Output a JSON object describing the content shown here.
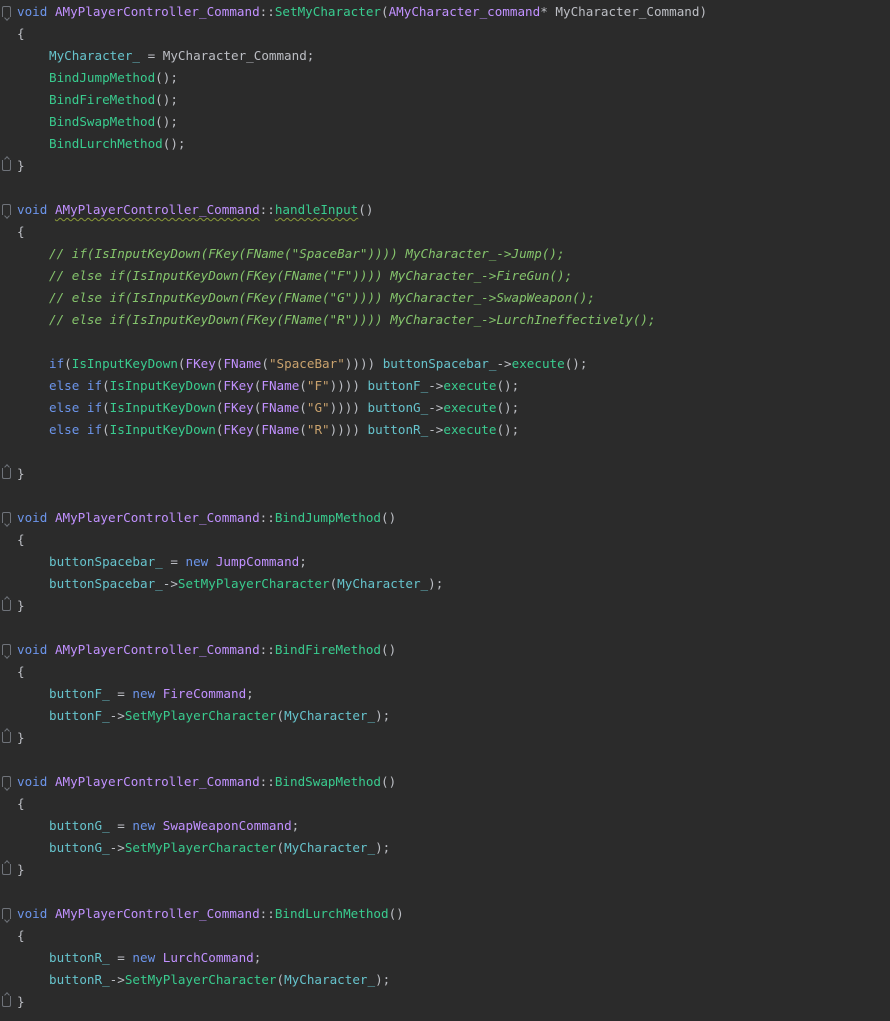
{
  "editor": {
    "theme": {
      "background": "#2b2b2b",
      "keyword": "#6c95eb",
      "type": "#c191ff",
      "function": "#39cc8f",
      "variable": "#66c3cc",
      "string": "#c9a26d",
      "comment": "#85c46c",
      "plain": "#bcbec4"
    },
    "lines": [
      {
        "fold": "open",
        "indent": 0,
        "tokens": [
          {
            "t": "void",
            "c": "kw"
          },
          {
            "t": " ",
            "c": "p"
          },
          {
            "t": "AMyPlayerController_Command",
            "c": "type"
          },
          {
            "t": "::",
            "c": "p"
          },
          {
            "t": "SetMyCharacter",
            "c": "fn"
          },
          {
            "t": "(",
            "c": "p"
          },
          {
            "t": "AMyCharacter_command",
            "c": "type"
          },
          {
            "t": "* MyCharacter_Command)",
            "c": "p"
          }
        ]
      },
      {
        "fold": "",
        "indent": 0,
        "tokens": [
          {
            "t": "{",
            "c": "p"
          }
        ]
      },
      {
        "fold": "",
        "indent": 1,
        "tokens": [
          {
            "t": "MyCharacter_",
            "c": "var"
          },
          {
            "t": " = MyCharacter_Command;",
            "c": "p"
          }
        ]
      },
      {
        "fold": "",
        "indent": 1,
        "tokens": [
          {
            "t": "BindJumpMethod",
            "c": "fn"
          },
          {
            "t": "();",
            "c": "p"
          }
        ]
      },
      {
        "fold": "",
        "indent": 1,
        "tokens": [
          {
            "t": "BindFireMethod",
            "c": "fn"
          },
          {
            "t": "();",
            "c": "p"
          }
        ]
      },
      {
        "fold": "",
        "indent": 1,
        "tokens": [
          {
            "t": "BindSwapMethod",
            "c": "fn"
          },
          {
            "t": "();",
            "c": "p"
          }
        ]
      },
      {
        "fold": "",
        "indent": 1,
        "tokens": [
          {
            "t": "BindLurchMethod",
            "c": "fn"
          },
          {
            "t": "();",
            "c": "p"
          }
        ]
      },
      {
        "fold": "close",
        "indent": 0,
        "tokens": [
          {
            "t": "}",
            "c": "p"
          }
        ]
      },
      {
        "fold": "",
        "indent": 0,
        "tokens": []
      },
      {
        "fold": "open",
        "indent": 0,
        "tokens": [
          {
            "t": "void",
            "c": "kw"
          },
          {
            "t": " ",
            "c": "p"
          },
          {
            "t": "AMyPlayerController_Command",
            "c": "type",
            "sq": true
          },
          {
            "t": "::",
            "c": "p"
          },
          {
            "t": "handleInput",
            "c": "fn",
            "sq": true
          },
          {
            "t": "()",
            "c": "p"
          }
        ]
      },
      {
        "fold": "",
        "indent": 0,
        "tokens": [
          {
            "t": "{",
            "c": "p"
          }
        ]
      },
      {
        "fold": "",
        "indent": 1,
        "tokens": [
          {
            "t": "// if(IsInputKeyDown(FKey(FName(\"SpaceBar\")))) MyCharacter_->Jump();",
            "c": "cm"
          }
        ]
      },
      {
        "fold": "",
        "indent": 1,
        "tokens": [
          {
            "t": "// else if(IsInputKeyDown(FKey(FName(\"F\")))) MyCharacter_->FireGun();",
            "c": "cm"
          }
        ]
      },
      {
        "fold": "",
        "indent": 1,
        "tokens": [
          {
            "t": "// else if(IsInputKeyDown(FKey(FName(\"G\")))) MyCharacter_->SwapWeapon();",
            "c": "cm"
          }
        ]
      },
      {
        "fold": "",
        "indent": 1,
        "tokens": [
          {
            "t": "// else if(IsInputKeyDown(FKey(FName(\"R\")))) MyCharacter_->LurchIneffectively();",
            "c": "cm"
          }
        ]
      },
      {
        "fold": "",
        "indent": 0,
        "tokens": []
      },
      {
        "fold": "",
        "indent": 1,
        "tokens": [
          {
            "t": "if",
            "c": "kw"
          },
          {
            "t": "(",
            "c": "p"
          },
          {
            "t": "IsInputKeyDown",
            "c": "fn"
          },
          {
            "t": "(",
            "c": "p"
          },
          {
            "t": "FKey",
            "c": "type"
          },
          {
            "t": "(",
            "c": "p"
          },
          {
            "t": "FName",
            "c": "type"
          },
          {
            "t": "(",
            "c": "p"
          },
          {
            "t": "\"SpaceBar\"",
            "c": "str"
          },
          {
            "t": ")))) ",
            "c": "p"
          },
          {
            "t": "buttonSpacebar_",
            "c": "var"
          },
          {
            "t": "->",
            "c": "p"
          },
          {
            "t": "execute",
            "c": "fn"
          },
          {
            "t": "();",
            "c": "p"
          }
        ]
      },
      {
        "fold": "",
        "indent": 1,
        "tokens": [
          {
            "t": "else if",
            "c": "kw"
          },
          {
            "t": "(",
            "c": "p"
          },
          {
            "t": "IsInputKeyDown",
            "c": "fn"
          },
          {
            "t": "(",
            "c": "p"
          },
          {
            "t": "FKey",
            "c": "type"
          },
          {
            "t": "(",
            "c": "p"
          },
          {
            "t": "FName",
            "c": "type"
          },
          {
            "t": "(",
            "c": "p"
          },
          {
            "t": "\"F\"",
            "c": "str"
          },
          {
            "t": ")))) ",
            "c": "p"
          },
          {
            "t": "buttonF_",
            "c": "var"
          },
          {
            "t": "->",
            "c": "p"
          },
          {
            "t": "execute",
            "c": "fn"
          },
          {
            "t": "();",
            "c": "p"
          }
        ]
      },
      {
        "fold": "",
        "indent": 1,
        "tokens": [
          {
            "t": "else if",
            "c": "kw"
          },
          {
            "t": "(",
            "c": "p"
          },
          {
            "t": "IsInputKeyDown",
            "c": "fn"
          },
          {
            "t": "(",
            "c": "p"
          },
          {
            "t": "FKey",
            "c": "type"
          },
          {
            "t": "(",
            "c": "p"
          },
          {
            "t": "FName",
            "c": "type"
          },
          {
            "t": "(",
            "c": "p"
          },
          {
            "t": "\"G\"",
            "c": "str"
          },
          {
            "t": ")))) ",
            "c": "p"
          },
          {
            "t": "buttonG_",
            "c": "var"
          },
          {
            "t": "->",
            "c": "p"
          },
          {
            "t": "execute",
            "c": "fn"
          },
          {
            "t": "();",
            "c": "p"
          }
        ]
      },
      {
        "fold": "",
        "indent": 1,
        "tokens": [
          {
            "t": "else if",
            "c": "kw"
          },
          {
            "t": "(",
            "c": "p"
          },
          {
            "t": "IsInputKeyDown",
            "c": "fn"
          },
          {
            "t": "(",
            "c": "p"
          },
          {
            "t": "FKey",
            "c": "type"
          },
          {
            "t": "(",
            "c": "p"
          },
          {
            "t": "FName",
            "c": "type"
          },
          {
            "t": "(",
            "c": "p"
          },
          {
            "t": "\"R\"",
            "c": "str"
          },
          {
            "t": ")))) ",
            "c": "p"
          },
          {
            "t": "buttonR_",
            "c": "var"
          },
          {
            "t": "->",
            "c": "p"
          },
          {
            "t": "execute",
            "c": "fn"
          },
          {
            "t": "();",
            "c": "p"
          }
        ]
      },
      {
        "fold": "",
        "indent": 0,
        "tokens": []
      },
      {
        "fold": "close",
        "indent": 0,
        "tokens": [
          {
            "t": "}",
            "c": "p"
          }
        ]
      },
      {
        "fold": "",
        "indent": 0,
        "tokens": []
      },
      {
        "fold": "open",
        "indent": 0,
        "tokens": [
          {
            "t": "void",
            "c": "kw"
          },
          {
            "t": " ",
            "c": "p"
          },
          {
            "t": "AMyPlayerController_Command",
            "c": "type"
          },
          {
            "t": "::",
            "c": "p"
          },
          {
            "t": "BindJumpMethod",
            "c": "fn"
          },
          {
            "t": "()",
            "c": "p"
          }
        ]
      },
      {
        "fold": "",
        "indent": 0,
        "tokens": [
          {
            "t": "{",
            "c": "p"
          }
        ]
      },
      {
        "fold": "",
        "indent": 1,
        "tokens": [
          {
            "t": "buttonSpacebar_",
            "c": "var"
          },
          {
            "t": " = ",
            "c": "p"
          },
          {
            "t": "new",
            "c": "kw"
          },
          {
            "t": " ",
            "c": "p"
          },
          {
            "t": "JumpCommand",
            "c": "type"
          },
          {
            "t": ";",
            "c": "p"
          }
        ]
      },
      {
        "fold": "",
        "indent": 1,
        "tokens": [
          {
            "t": "buttonSpacebar_",
            "c": "var"
          },
          {
            "t": "->",
            "c": "p"
          },
          {
            "t": "SetMyPlayerCharacter",
            "c": "fn"
          },
          {
            "t": "(",
            "c": "p"
          },
          {
            "t": "MyCharacter_",
            "c": "var"
          },
          {
            "t": ");",
            "c": "p"
          }
        ]
      },
      {
        "fold": "close",
        "indent": 0,
        "tokens": [
          {
            "t": "}",
            "c": "p"
          }
        ]
      },
      {
        "fold": "",
        "indent": 0,
        "tokens": []
      },
      {
        "fold": "open",
        "indent": 0,
        "tokens": [
          {
            "t": "void",
            "c": "kw"
          },
          {
            "t": " ",
            "c": "p"
          },
          {
            "t": "AMyPlayerController_Command",
            "c": "type"
          },
          {
            "t": "::",
            "c": "p"
          },
          {
            "t": "BindFireMethod",
            "c": "fn"
          },
          {
            "t": "()",
            "c": "p"
          }
        ]
      },
      {
        "fold": "",
        "indent": 0,
        "tokens": [
          {
            "t": "{",
            "c": "p"
          }
        ]
      },
      {
        "fold": "",
        "indent": 1,
        "tokens": [
          {
            "t": "buttonF_",
            "c": "var"
          },
          {
            "t": " = ",
            "c": "p"
          },
          {
            "t": "new",
            "c": "kw"
          },
          {
            "t": " ",
            "c": "p"
          },
          {
            "t": "FireCommand",
            "c": "type"
          },
          {
            "t": ";",
            "c": "p"
          }
        ]
      },
      {
        "fold": "",
        "indent": 1,
        "tokens": [
          {
            "t": "buttonF_",
            "c": "var"
          },
          {
            "t": "->",
            "c": "p"
          },
          {
            "t": "SetMyPlayerCharacter",
            "c": "fn"
          },
          {
            "t": "(",
            "c": "p"
          },
          {
            "t": "MyCharacter_",
            "c": "var"
          },
          {
            "t": ");",
            "c": "p"
          }
        ]
      },
      {
        "fold": "close",
        "indent": 0,
        "tokens": [
          {
            "t": "}",
            "c": "p"
          }
        ]
      },
      {
        "fold": "",
        "indent": 0,
        "tokens": []
      },
      {
        "fold": "open",
        "indent": 0,
        "tokens": [
          {
            "t": "void",
            "c": "kw"
          },
          {
            "t": " ",
            "c": "p"
          },
          {
            "t": "AMyPlayerController_Command",
            "c": "type"
          },
          {
            "t": "::",
            "c": "p"
          },
          {
            "t": "BindSwapMethod",
            "c": "fn"
          },
          {
            "t": "()",
            "c": "p"
          }
        ]
      },
      {
        "fold": "",
        "indent": 0,
        "tokens": [
          {
            "t": "{",
            "c": "p"
          }
        ]
      },
      {
        "fold": "",
        "indent": 1,
        "tokens": [
          {
            "t": "buttonG_",
            "c": "var"
          },
          {
            "t": " = ",
            "c": "p"
          },
          {
            "t": "new",
            "c": "kw"
          },
          {
            "t": " ",
            "c": "p"
          },
          {
            "t": "SwapWeaponCommand",
            "c": "type"
          },
          {
            "t": ";",
            "c": "p"
          }
        ]
      },
      {
        "fold": "",
        "indent": 1,
        "tokens": [
          {
            "t": "buttonG_",
            "c": "var"
          },
          {
            "t": "->",
            "c": "p"
          },
          {
            "t": "SetMyPlayerCharacter",
            "c": "fn"
          },
          {
            "t": "(",
            "c": "p"
          },
          {
            "t": "MyCharacter_",
            "c": "var"
          },
          {
            "t": ");",
            "c": "p"
          }
        ]
      },
      {
        "fold": "close",
        "indent": 0,
        "tokens": [
          {
            "t": "}",
            "c": "p"
          }
        ]
      },
      {
        "fold": "",
        "indent": 0,
        "tokens": []
      },
      {
        "fold": "open",
        "indent": 0,
        "tokens": [
          {
            "t": "void",
            "c": "kw"
          },
          {
            "t": " ",
            "c": "p"
          },
          {
            "t": "AMyPlayerController_Command",
            "c": "type"
          },
          {
            "t": "::",
            "c": "p"
          },
          {
            "t": "BindLurchMethod",
            "c": "fn"
          },
          {
            "t": "()",
            "c": "p"
          }
        ]
      },
      {
        "fold": "",
        "indent": 0,
        "tokens": [
          {
            "t": "{",
            "c": "p"
          }
        ]
      },
      {
        "fold": "",
        "indent": 1,
        "tokens": [
          {
            "t": "buttonR_",
            "c": "var"
          },
          {
            "t": " = ",
            "c": "p"
          },
          {
            "t": "new",
            "c": "kw"
          },
          {
            "t": " ",
            "c": "p"
          },
          {
            "t": "LurchCommand",
            "c": "type"
          },
          {
            "t": ";",
            "c": "p"
          }
        ]
      },
      {
        "fold": "",
        "indent": 1,
        "tokens": [
          {
            "t": "buttonR_",
            "c": "var"
          },
          {
            "t": "->",
            "c": "p"
          },
          {
            "t": "SetMyPlayerCharacter",
            "c": "fn"
          },
          {
            "t": "(",
            "c": "p"
          },
          {
            "t": "MyCharacter_",
            "c": "var"
          },
          {
            "t": ");",
            "c": "p"
          }
        ]
      },
      {
        "fold": "close",
        "indent": 0,
        "tokens": [
          {
            "t": "}",
            "c": "p"
          }
        ]
      }
    ]
  }
}
